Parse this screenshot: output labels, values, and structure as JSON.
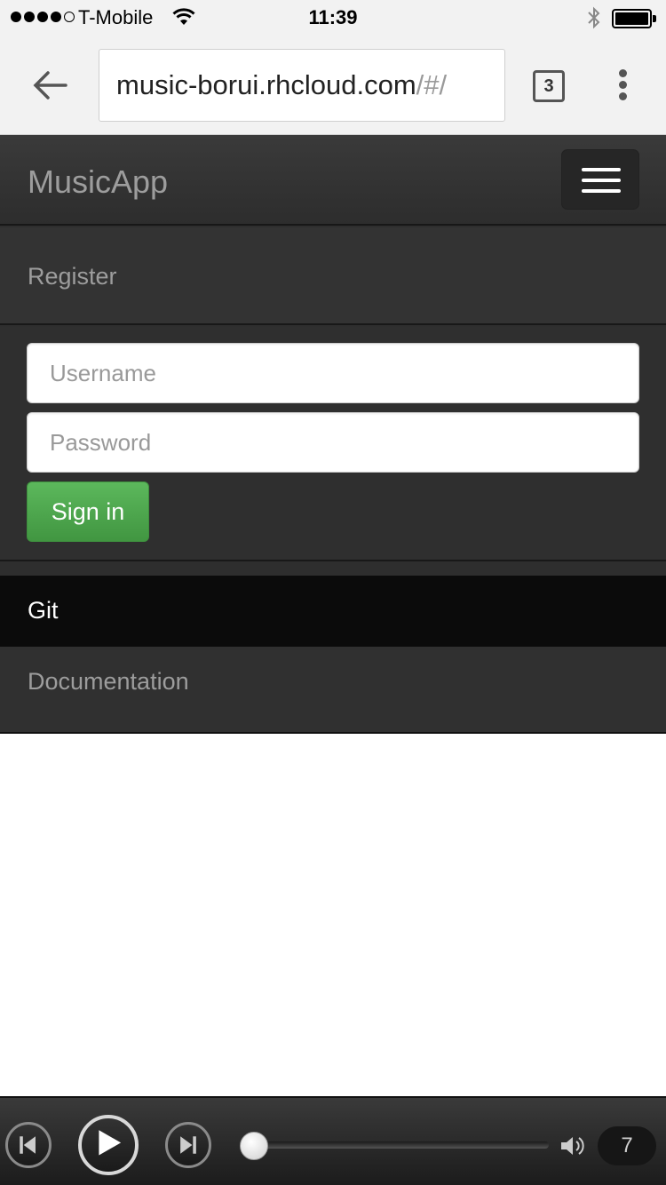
{
  "status_bar": {
    "carrier": "T-Mobile",
    "time": "11:39",
    "signal_strength": 4,
    "signal_max": 5,
    "battery_level": 1.0
  },
  "browser": {
    "url_host": "music-borui.rhcloud.com",
    "url_path": "/#/",
    "tab_count": "3"
  },
  "navbar": {
    "brand": "MusicApp",
    "register_label": "Register",
    "git_label": "Git",
    "docs_label": "Documentation",
    "active_item": "Git"
  },
  "signin_form": {
    "username_placeholder": "Username",
    "password_placeholder": "Password",
    "username_value": "",
    "password_value": "",
    "submit_label": "Sign in"
  },
  "player": {
    "progress": 0.0,
    "volume_level": "7"
  },
  "colors": {
    "navbar_bg": "#2e2e2e",
    "active_item_bg": "#0b0b0b",
    "success_green": "#5cb85c",
    "muted_text": "#9d9d9d"
  }
}
